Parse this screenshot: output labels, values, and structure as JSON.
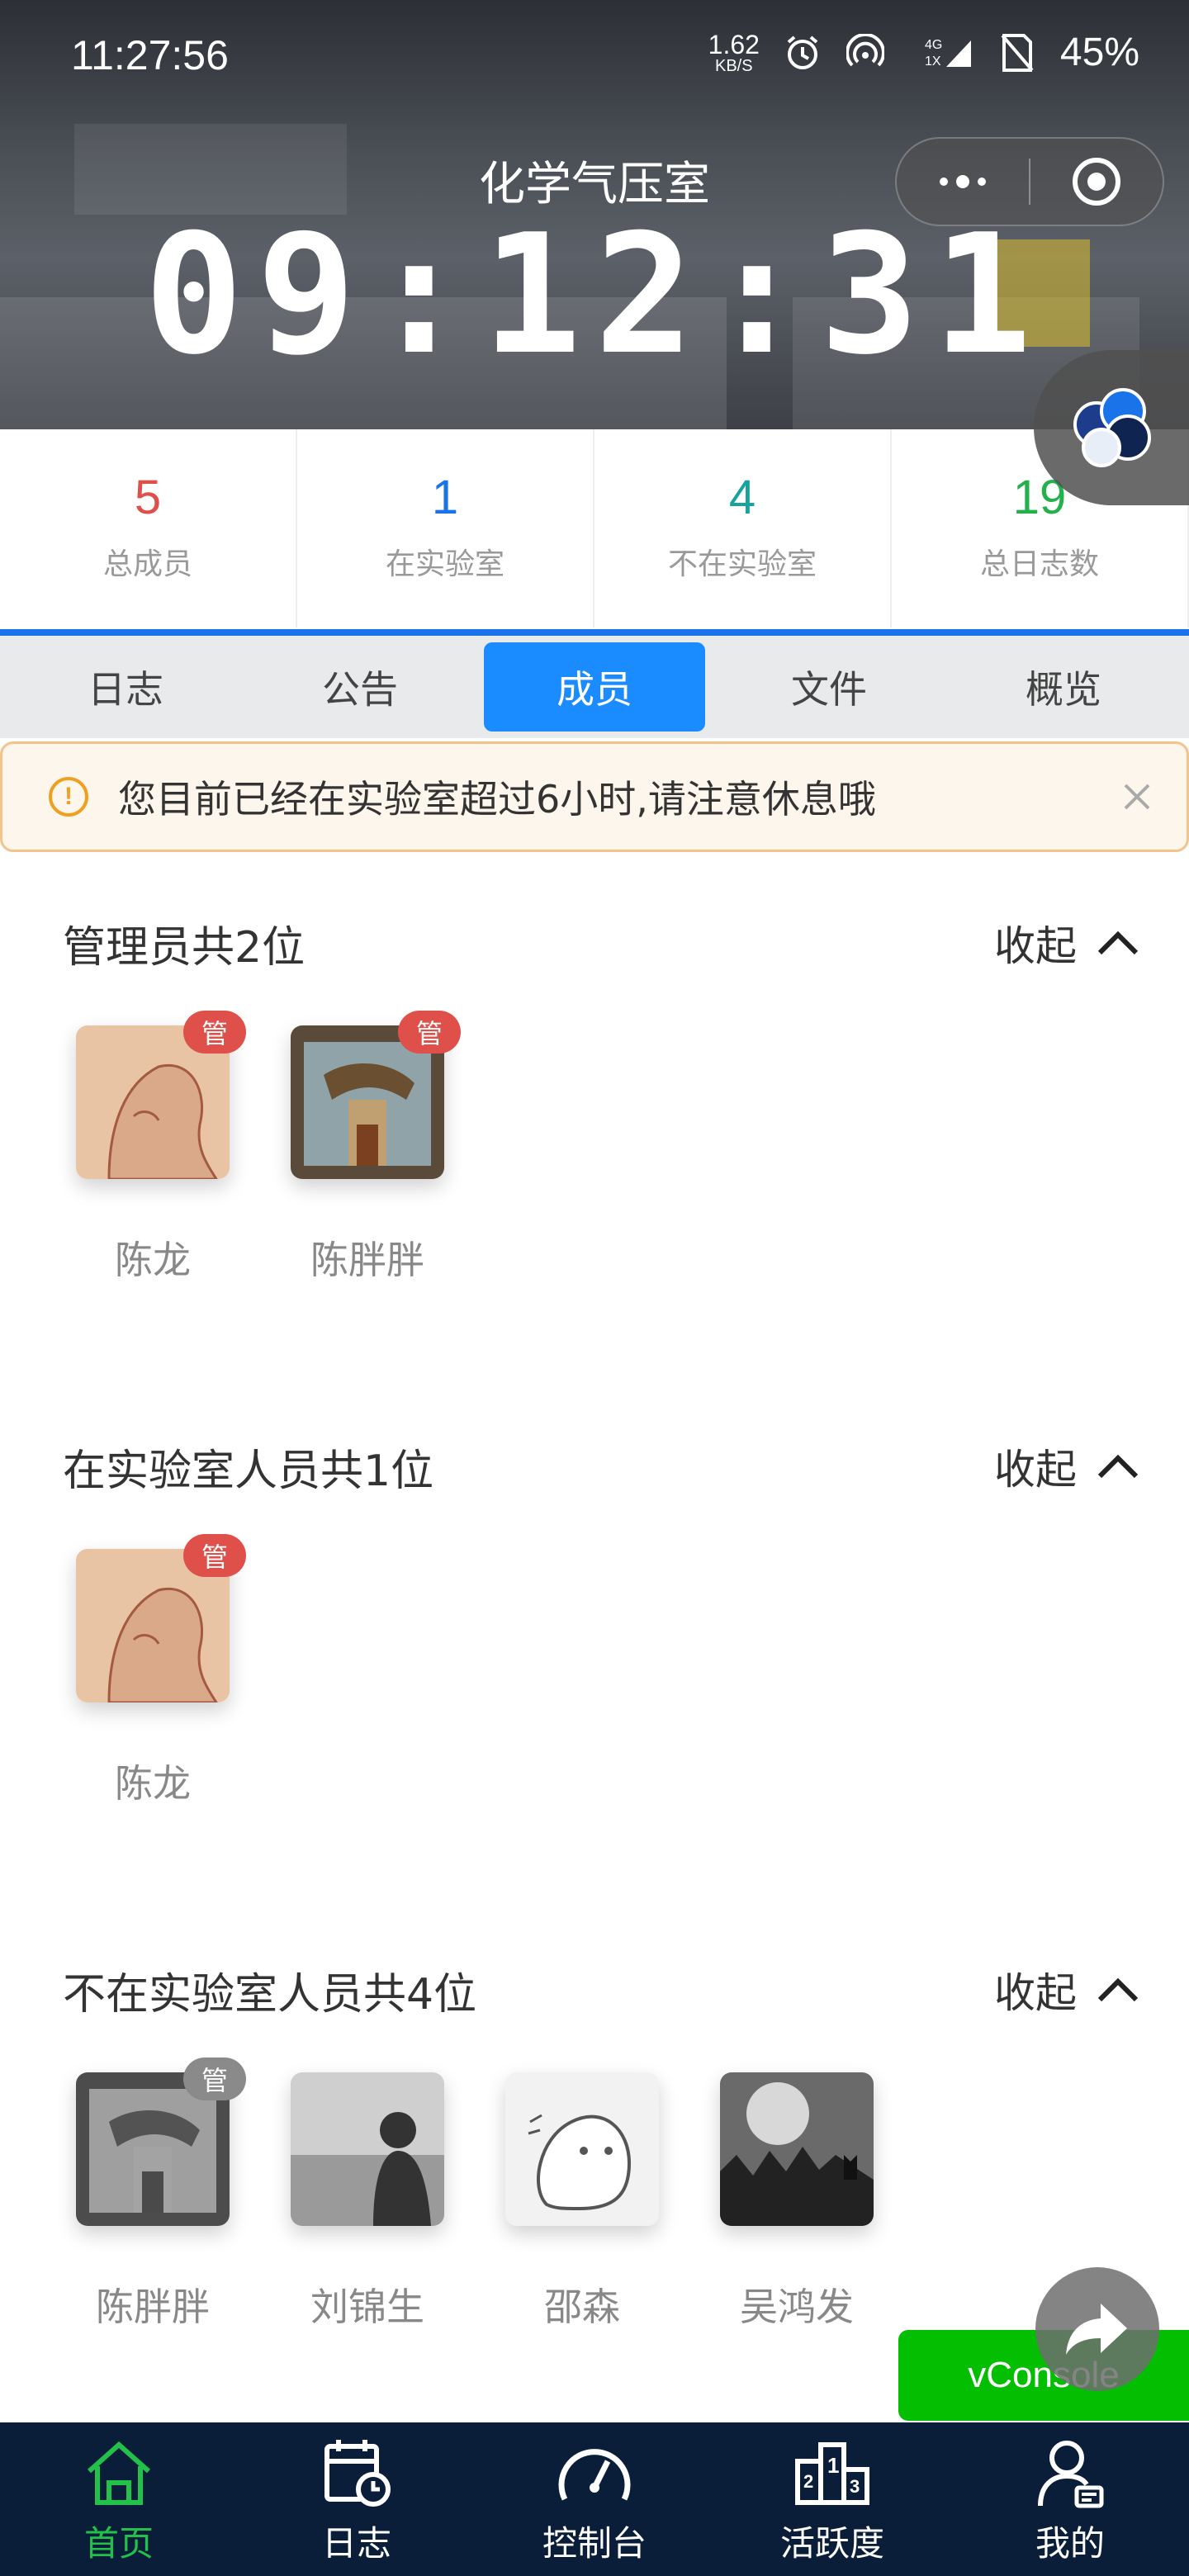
{
  "status_bar": {
    "time": "11:27:56",
    "net_speed": "1.62",
    "net_unit": "KB/S",
    "network": "4G",
    "network_sub": "1X",
    "battery": "45%"
  },
  "header": {
    "title": "化学气压室",
    "timer": "09:12:31"
  },
  "stats": [
    {
      "value": "5",
      "label": "总成员",
      "color": "#e0504a"
    },
    {
      "value": "1",
      "label": "在实验室",
      "color": "#1a73e8"
    },
    {
      "value": "4",
      "label": "不在实验室",
      "color": "#17a2a0"
    },
    {
      "value": "19",
      "label": "总日志数",
      "color": "#22b14c"
    }
  ],
  "tabs": [
    {
      "label": "日志",
      "active": false
    },
    {
      "label": "公告",
      "active": false
    },
    {
      "label": "成员",
      "active": true
    },
    {
      "label": "文件",
      "active": false
    },
    {
      "label": "概览",
      "active": false
    }
  ],
  "notice": {
    "text": "您目前已经在实验室超过6小时,请注意休息哦"
  },
  "sections": [
    {
      "title": "管理员共2位",
      "toggle": "收起",
      "members": [
        {
          "name": "陈龙",
          "badge": "管"
        },
        {
          "name": "陈胖胖",
          "badge": "管"
        }
      ]
    },
    {
      "title": "在实验室人员共1位",
      "toggle": "收起",
      "members": [
        {
          "name": "陈龙",
          "badge": "管"
        }
      ]
    },
    {
      "title": "不在实验室人员共4位",
      "toggle": "收起",
      "members": [
        {
          "name": "陈胖胖",
          "badge": "管"
        },
        {
          "name": "刘锦生"
        },
        {
          "name": "邵森"
        },
        {
          "name": "吴鸿发"
        }
      ]
    }
  ],
  "vconsole": "vConsole",
  "bottom_nav": [
    {
      "label": "首页",
      "icon": "home-icon",
      "active": true
    },
    {
      "label": "日志",
      "icon": "calendar-clock-icon",
      "active": false
    },
    {
      "label": "控制台",
      "icon": "gauge-icon",
      "active": false
    },
    {
      "label": "活跃度",
      "icon": "podium-icon",
      "active": false
    },
    {
      "label": "我的",
      "icon": "user-icon",
      "active": false
    }
  ],
  "colors": {
    "accent": "#1a8cff",
    "nav_bg": "#0a1e3a",
    "nav_active": "#22c14a",
    "admin_badge": "#e0504a"
  }
}
